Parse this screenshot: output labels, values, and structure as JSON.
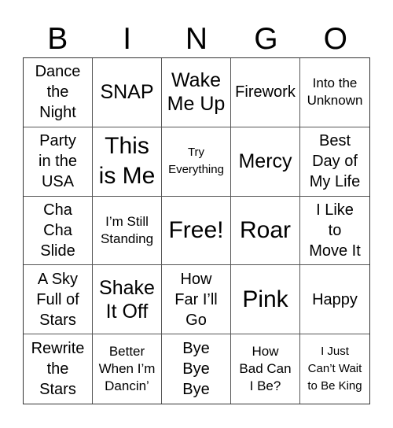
{
  "header": [
    "B",
    "I",
    "N",
    "G",
    "O"
  ],
  "cells": [
    {
      "text": "Dance\nthe\nNight",
      "size": "s-m"
    },
    {
      "text": "SNAP",
      "size": "s-l"
    },
    {
      "text": "Wake\nMe Up",
      "size": "s-l"
    },
    {
      "text": "Firework",
      "size": "s-m"
    },
    {
      "text": "Into the\nUnknown",
      "size": "s-s"
    },
    {
      "text": "Party\nin the\nUSA",
      "size": "s-m"
    },
    {
      "text": "This\nis Me",
      "size": "s-xl"
    },
    {
      "text": "Try\nEverything",
      "size": "s-xs"
    },
    {
      "text": "Mercy",
      "size": "s-l"
    },
    {
      "text": "Best\nDay of\nMy Life",
      "size": "s-m"
    },
    {
      "text": "Cha\nCha\nSlide",
      "size": "s-m"
    },
    {
      "text": "I’m Still\nStanding",
      "size": "s-s"
    },
    {
      "text": "Free!",
      "size": "s-xl"
    },
    {
      "text": "Roar",
      "size": "s-xl"
    },
    {
      "text": "I Like\nto\nMove It",
      "size": "s-m"
    },
    {
      "text": "A Sky\nFull of\nStars",
      "size": "s-m"
    },
    {
      "text": "Shake\nIt Off",
      "size": "s-l"
    },
    {
      "text": "How\nFar I’ll\nGo",
      "size": "s-m"
    },
    {
      "text": "Pink",
      "size": "s-xl"
    },
    {
      "text": "Happy",
      "size": "s-m"
    },
    {
      "text": "Rewrite\nthe\nStars",
      "size": "s-m"
    },
    {
      "text": "Better\nWhen I’m\nDancin’",
      "size": "s-s"
    },
    {
      "text": "Bye\nBye\nBye",
      "size": "s-m"
    },
    {
      "text": "How\nBad Can\nI Be?",
      "size": "s-s"
    },
    {
      "text": "I Just\nCan’t Wait\nto Be King",
      "size": "s-xs"
    }
  ]
}
